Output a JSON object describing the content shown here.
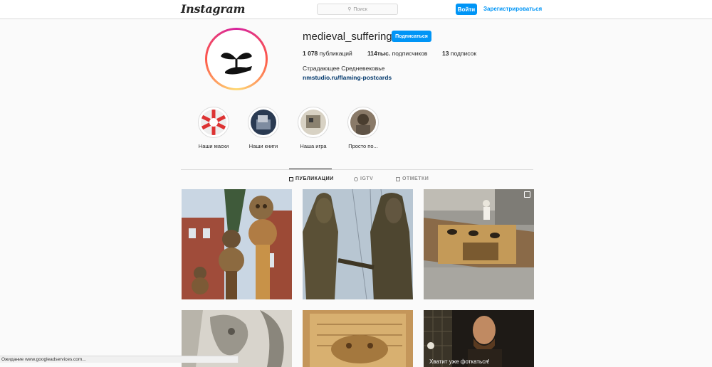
{
  "nav": {
    "logo": "Instagram",
    "search_placeholder": "Поиск",
    "login_label": "Войти",
    "register_label": "Зарегистрироваться"
  },
  "profile": {
    "username": "medieval_suffering",
    "follow_label": "Подписаться",
    "posts_count": "1 078",
    "posts_label": "публикаций",
    "followers_count": "114тыс.",
    "followers_label": "подписчиков",
    "following_count": "13",
    "following_label": "подписок",
    "full_name": "Страдающее Средневековье",
    "link": "nmstudio.ru/flaming-postcards"
  },
  "highlights": [
    {
      "label": "Наши маски"
    },
    {
      "label": "Наши книги"
    },
    {
      "label": "Наша игра"
    },
    {
      "label": "Просто по..."
    }
  ],
  "tabs": [
    {
      "label": "ПУБЛИКАЦИИ",
      "icon": "grid-icon"
    },
    {
      "label": "IGTV",
      "icon": "igtv-icon"
    },
    {
      "label": "ОТМЕТКИ",
      "icon": "tag-icon"
    }
  ],
  "posts": [
    {
      "caption": ""
    },
    {
      "caption": ""
    },
    {
      "caption": ""
    },
    {
      "caption": ""
    },
    {
      "caption": ""
    },
    {
      "caption": "Хватит уже фоткаться!"
    }
  ],
  "status_bar": "Ожидание www.googleadservices.com...",
  "colors": {
    "accent": "#0095f6",
    "link": "#00376b",
    "border": "#dbdbdb"
  }
}
